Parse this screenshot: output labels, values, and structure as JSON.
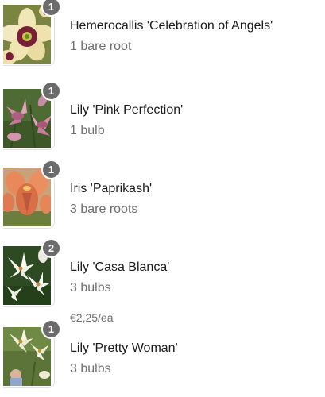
{
  "cart_items": [
    {
      "count": "1",
      "name": "Hemerocallis 'Celebration of Angels'",
      "quantity": "1 bare root",
      "image": "daylily-cream-maroon-photo"
    },
    {
      "count": "1",
      "name": "Lily 'Pink Perfection'",
      "quantity": "1 bulb",
      "image": "pink-trumpet-lily-photo"
    },
    {
      "count": "1",
      "name": "Iris 'Paprikash'",
      "quantity": "3 bare roots",
      "image": "orange-iris-photo"
    },
    {
      "count": "2",
      "name": "Lily 'Casa Blanca'",
      "quantity": "3 bulbs",
      "price": "€2,25/ea",
      "image": "white-lily-photo"
    },
    {
      "count": "1",
      "name": "Lily 'Pretty Woman'",
      "quantity": "3 bulbs",
      "image": "cream-lily-photo"
    }
  ],
  "colors": {
    "badge": "#6b6b6b",
    "name_text": "#1a1a1a",
    "secondary_text": "#6e6e6e"
  }
}
